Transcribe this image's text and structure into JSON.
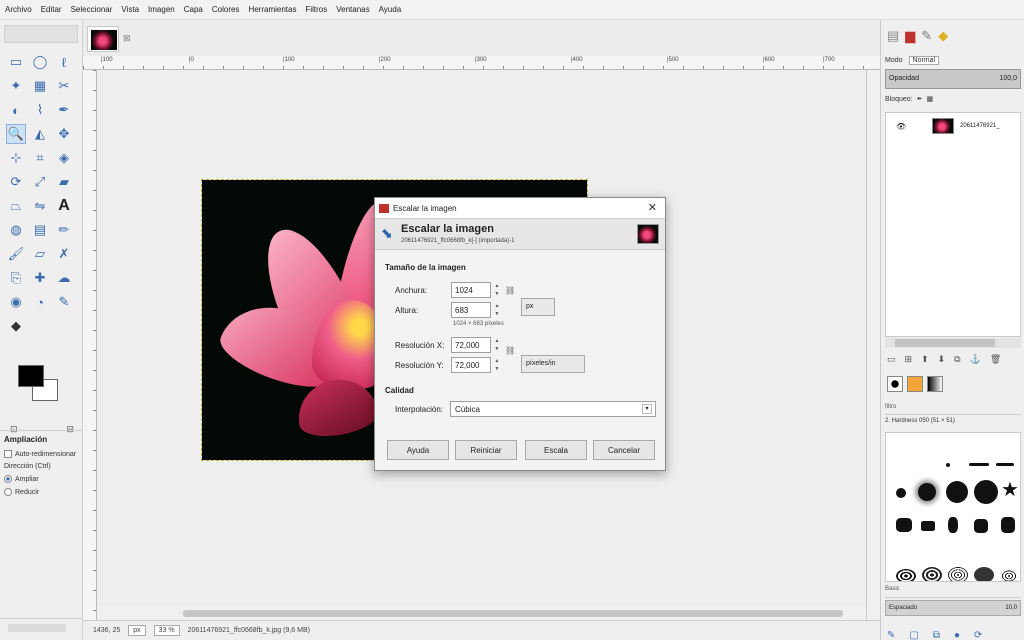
{
  "menu": [
    "Archivo",
    "Editar",
    "Seleccionar",
    "Vista",
    "Imagen",
    "Capa",
    "Colores",
    "Herramientas",
    "Filtros",
    "Ventanas",
    "Ayuda"
  ],
  "tool_options": {
    "title": "Ampliación",
    "auto_resize": "Auto-redimensionar",
    "direction_label": "Dirección (Ctrl)",
    "zoom_in": "Ampliar",
    "zoom_out": "Reducir"
  },
  "ruler_marks": [
    "|100",
    "|0",
    "|100",
    "|200",
    "|300",
    "|400",
    "|500",
    "|600",
    "|700"
  ],
  "status": {
    "coords": "1436, 25",
    "unit": "px",
    "zoom": "33 %",
    "filename": "20611476921_ffc0668fb_k.jpg (9,6 MB)"
  },
  "dialog": {
    "window_title": "Escalar la imagen",
    "header_title": "Escalar la imagen",
    "header_subtitle": "20611476921_ffc0668fb_k[-] (importada)-1",
    "size_section": "Tamaño de la imagen",
    "width_label": "Anchura:",
    "width_value": "1024",
    "height_label": "Altura:",
    "height_value": "683",
    "size_unit": "px",
    "pixels_hint": "1024 × 683 píxeles",
    "xres_label": "Resolución X:",
    "xres_value": "72,000",
    "yres_label": "Resolución Y:",
    "yres_value": "72,000",
    "res_unit": "píxeles/in",
    "quality_section": "Calidad",
    "interp_label": "Interpolación:",
    "interp_value": "Cúbica",
    "buttons": {
      "help": "Ayuda",
      "reset": "Reiniciar",
      "scale": "Escala",
      "cancel": "Cancelar"
    }
  },
  "layers_panel": {
    "mode_label": "Modo",
    "mode_value": "Normal",
    "opacity_label": "Opacidad",
    "opacity_value": "100,0",
    "lock_label": "Bloqueo:",
    "layer_name": "20611476921_"
  },
  "brushes_panel": {
    "filter_placeholder": "filtro",
    "brush_name": "2. Hardness 050 (51 × 51)",
    "tag_label": "Basic",
    "spacing_label": "Espaciado",
    "spacing_value": "10,0"
  },
  "colors": {
    "accent": "#3b6cb0",
    "dialog_icon_red": "#c0302c",
    "photo_background": "#040905",
    "petal_pink": "#f0487a"
  }
}
